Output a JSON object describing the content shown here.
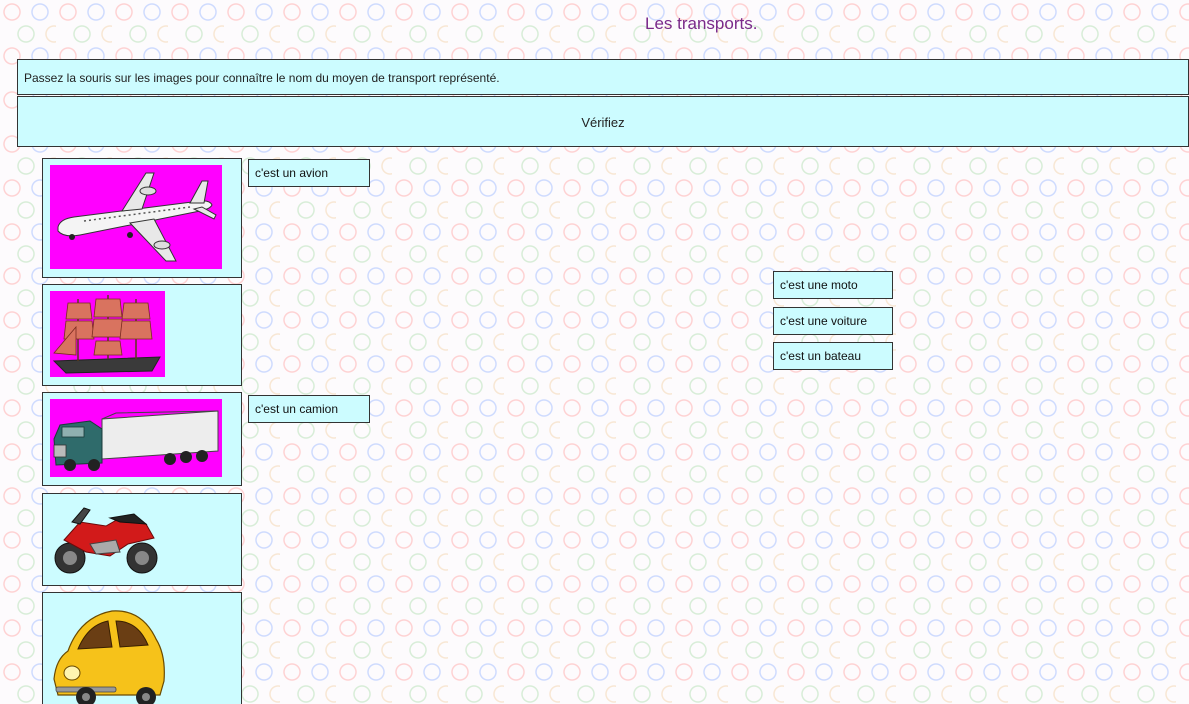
{
  "page": {
    "title": "Les transports.",
    "instructions": "Passez la souris sur les images pour connaître le nom du moyen de transport représenté.",
    "check_label": "Vérifiez"
  },
  "images": [
    {
      "name": "airplane-image",
      "icon": "airplane",
      "bg": "#ff00ff"
    },
    {
      "name": "sailing-ship-image",
      "icon": "sailing-ship",
      "bg": "#ff00ff"
    },
    {
      "name": "truck-image",
      "icon": "truck",
      "bg": "#ff00ff"
    },
    {
      "name": "motorcycle-image",
      "icon": "motorcycle",
      "bg": "#ccfcff"
    },
    {
      "name": "car-image",
      "icon": "car",
      "bg": "#ccfcff"
    }
  ],
  "labels": {
    "avion": "c'est un avion",
    "camion": "c'est un camion",
    "moto": "c'est une moto",
    "voiture": "c'est une voiture",
    "bateau": "c'est un bateau"
  }
}
